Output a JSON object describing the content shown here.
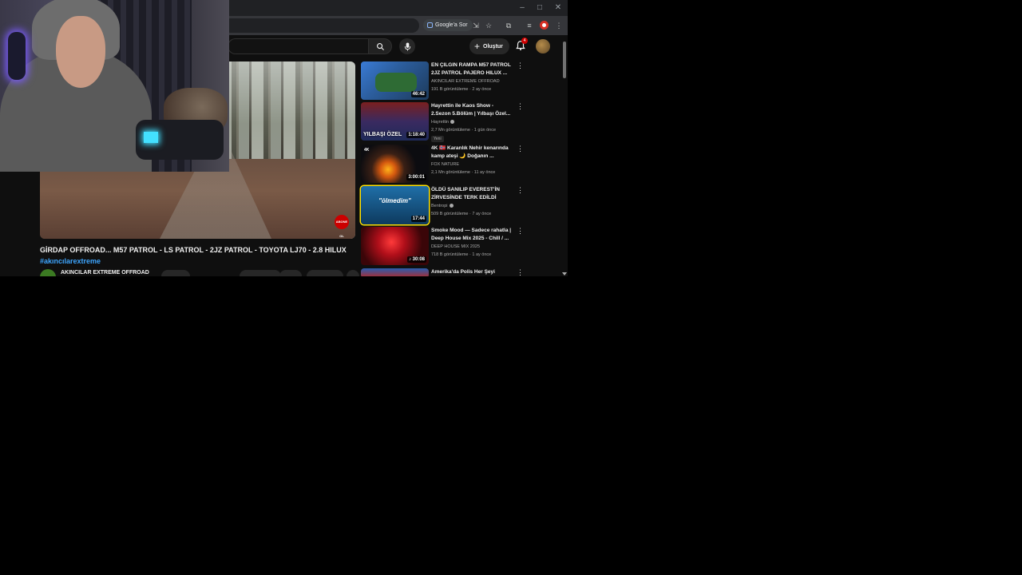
{
  "browser": {
    "google_sor_label": "Google'a Sor",
    "minimize": "–",
    "maximize": "□",
    "close": "✕"
  },
  "header": {
    "create_label": "Oluştur",
    "notification_count": "4"
  },
  "video": {
    "title": "GİRDAP OFFROAD... M57 PATROL - LS PATROL - 2JZ PATROL - TOYOTA LJ70 - 2.8 HILUX",
    "hashtag": "#akıncılarextreme",
    "channel": "AKINCILAR EXTREME OFFROAD",
    "overlay_badge": "ABONE OL"
  },
  "sidebar": {
    "items": [
      {
        "title": "EN ÇILGIN RAMPA M57 PATROL 2JZ PATROL PAJERO HILUX ...",
        "channel": "AKINCILAR EXTREME OFFROAD",
        "meta": "191 B görüntüleme · 2 ay önce",
        "duration": "46:42",
        "thumb_text": ""
      },
      {
        "title": "Hayrettin ile Kaos Show - 2.Sezon 5.Bölüm | Yılbaşı Özel...",
        "channel": "Hayrettin",
        "meta": "2,7 Mn görüntüleme · 1 gün önce",
        "duration": "1:18:40",
        "thumb_text": "YILBAŞI ÖZEL",
        "badge": "Yeni"
      },
      {
        "title": "4K 🇳🇴 Karanlık Nehir kenarında kamp ateşi 🌙 Doğanın ...",
        "channel": "FOX NATURE",
        "meta": "2,1 Mn görüntüleme · 11 ay önce",
        "duration": "3:00:01",
        "thumb_text": "4K"
      },
      {
        "title": "ÖLDÜ SANILIP EVEREST'İN ZİRVESİNDE TERK EDİLDİ",
        "channel": "Bentropi",
        "meta": "509 B görüntüleme · 7 ay önce",
        "duration": "17:44",
        "thumb_text": "\"ölmedim\""
      },
      {
        "title": "Smoke Mood — Sadece rahatla | Deep House Mix 2025 - Chill / ...",
        "channel": "DEEP HOUSE MIX 2025",
        "meta": "718 B görüntüleme · 1 ay önce",
        "duration": "30:08",
        "thumb_text": ""
      },
      {
        "title": "Amerika'da Polis Her Şeyi",
        "channel": "",
        "meta": "",
        "duration": "",
        "thumb_text": ""
      }
    ]
  },
  "colors": {
    "accent_link": "#3ea6ff",
    "selected_border": "#ffe000",
    "youtube_red": "#cc0000",
    "background": "#0f0f0f"
  }
}
